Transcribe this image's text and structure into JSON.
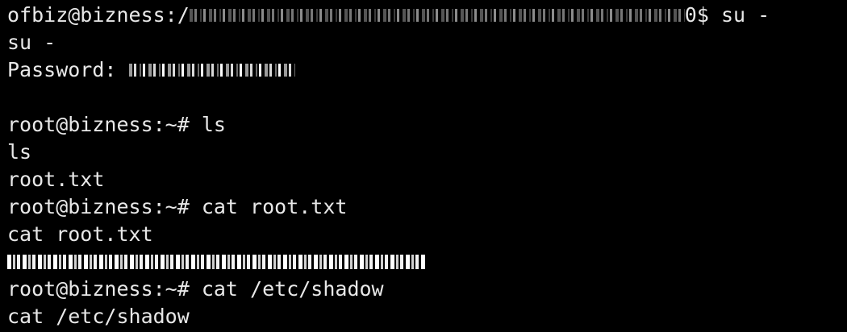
{
  "terminal": {
    "lines": [
      {
        "prompt": "ofbiz@bizness:/",
        "path_suffix": "0$",
        "command": " su -"
      },
      {
        "text": "su -"
      },
      {
        "label": "Password: "
      },
      {
        "text": ""
      },
      {
        "prompt": "root@bizness:~#",
        "command": " ls"
      },
      {
        "text": "ls"
      },
      {
        "text": "root.txt"
      },
      {
        "prompt": "root@bizness:~#",
        "command": " cat root.txt"
      },
      {
        "text": "cat root.txt"
      },
      {
        "text": ""
      },
      {
        "prompt": "root@bizness:~#",
        "command": " cat /etc/shadow"
      },
      {
        "text": "cat /etc/shadow"
      }
    ]
  },
  "colors": {
    "background": "#000000",
    "foreground": "#e8e8e8"
  }
}
